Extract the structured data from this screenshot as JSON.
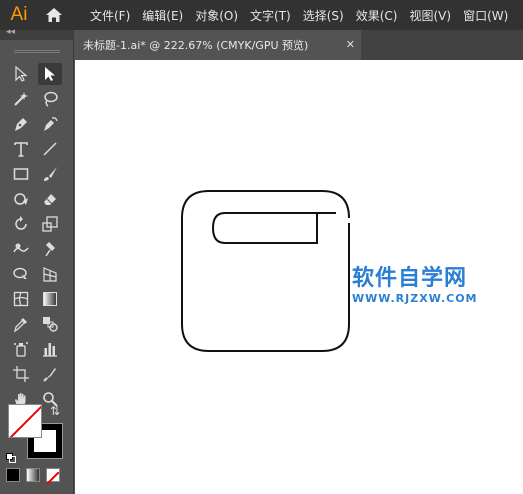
{
  "app": {
    "logo": "Ai"
  },
  "menu": [
    "文件(F)",
    "编辑(E)",
    "对象(O)",
    "文字(T)",
    "选择(S)",
    "效果(C)",
    "视图(V)",
    "窗口(W)"
  ],
  "panel": {
    "collapse": "◂◂"
  },
  "document": {
    "tab_title": "未标题-1.ai* @ 222.67% (CMYK/GPU 预览)",
    "close_glyph": "✕"
  },
  "watermark": {
    "title": "软件自学网",
    "url": "WWW.RJZXW.COM"
  },
  "colors": {
    "accent": "#ff9a00",
    "watermark": "#2a7fd4",
    "menubar": "#323232",
    "panel": "#535353"
  },
  "tools": [
    "selection-tool",
    "direct-selection-tool",
    "magic-wand-tool",
    "lasso-tool",
    "pen-tool",
    "curvature-tool",
    "type-tool",
    "line-segment-tool",
    "rectangle-tool",
    "paintbrush-tool",
    "shaper-tool",
    "eraser-tool",
    "rotate-tool",
    "scale-tool",
    "warp-tool",
    "puppet-warp-tool",
    "shape-builder-tool",
    "perspective-grid-tool",
    "mesh-tool",
    "gradient-tool",
    "eyedropper-tool",
    "blend-tool",
    "symbol-sprayer-tool",
    "column-graph-tool",
    "artboard-tool",
    "slice-tool",
    "hand-tool",
    "zoom-tool"
  ]
}
